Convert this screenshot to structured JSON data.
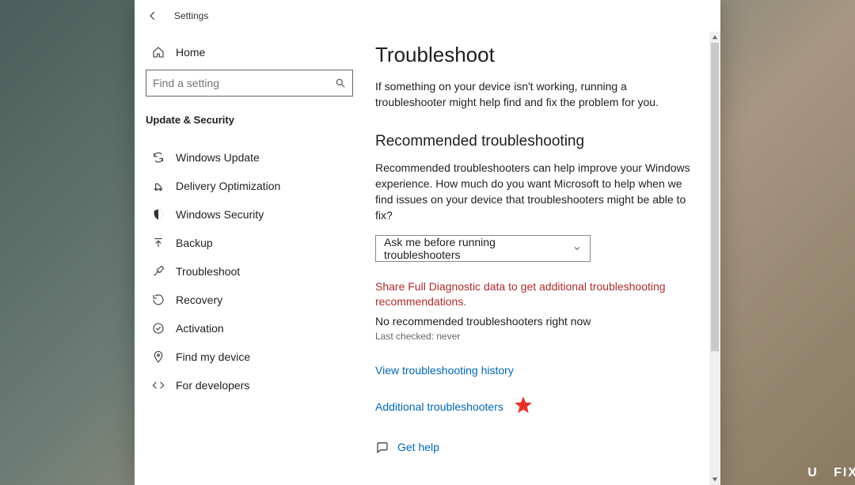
{
  "window": {
    "title": "Settings"
  },
  "sidebar": {
    "home": "Home",
    "search_placeholder": "Find a setting",
    "section": "Update & Security",
    "items": [
      {
        "label": "Windows Update"
      },
      {
        "label": "Delivery Optimization"
      },
      {
        "label": "Windows Security"
      },
      {
        "label": "Backup"
      },
      {
        "label": "Troubleshoot"
      },
      {
        "label": "Recovery"
      },
      {
        "label": "Activation"
      },
      {
        "label": "Find my device"
      },
      {
        "label": "For developers"
      }
    ]
  },
  "main": {
    "title": "Troubleshoot",
    "intro": "If something on your device isn't working, running a troubleshooter might help find and fix the problem for you.",
    "recommended_heading": "Recommended troubleshooting",
    "recommended_text": "Recommended troubleshooters can help improve your Windows experience. How much do you want Microsoft to help when we find issues on your device that troubleshooters might be able to fix?",
    "dropdown_value": "Ask me before running troubleshooters",
    "share_link": "Share Full Diagnostic data to get additional troubleshooting recommendations.",
    "no_recommended": "No recommended troubleshooters right now",
    "last_checked": "Last checked: never",
    "history_link": "View troubleshooting history",
    "additional_link": "Additional troubleshooters",
    "get_help": "Get help"
  },
  "watermark": {
    "u": "U",
    "fix": "FIX"
  }
}
